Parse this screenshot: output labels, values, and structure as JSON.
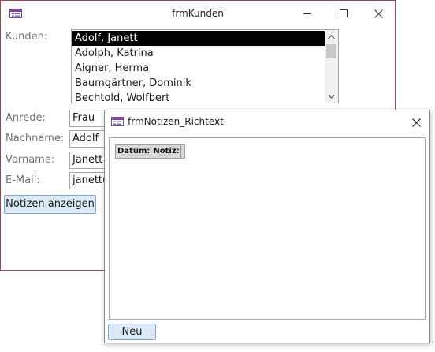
{
  "kunden_window": {
    "title": "frmKunden",
    "kunden_label": "Kunden:",
    "customers": [
      "Adolf, Janett",
      "Adolph, Katrina",
      "Aigner, Herma",
      "Baumgärtner, Dominik",
      "Bechtold, Wolfbert"
    ],
    "selected_index": 0,
    "fields": {
      "anrede": {
        "label": "Anrede:",
        "value": "Frau"
      },
      "nachname": {
        "label": "Nachname:",
        "value": "Adolf"
      },
      "vorname": {
        "label": "Vorname:",
        "value": "Janett"
      },
      "email": {
        "label": "E-Mail:",
        "value": "janett("
      }
    },
    "notizen_button": "Notizen anzeigen"
  },
  "notizen_window": {
    "title": "frmNotizen_Richtext",
    "columns": [
      "Datum:",
      "Notiz:"
    ],
    "neu_button": "Neu"
  },
  "colors": {
    "kunden_border": "#a0404a",
    "button_bg": "#dce9f7",
    "button_border": "#89a7cc",
    "selection_bg": "#000000"
  },
  "icons": {
    "form": "form-icon",
    "minimize": "minimize-icon",
    "maximize": "maximize-icon",
    "close": "close-icon",
    "scroll_up": "chevron-up-icon",
    "scroll_down": "chevron-down-icon"
  }
}
